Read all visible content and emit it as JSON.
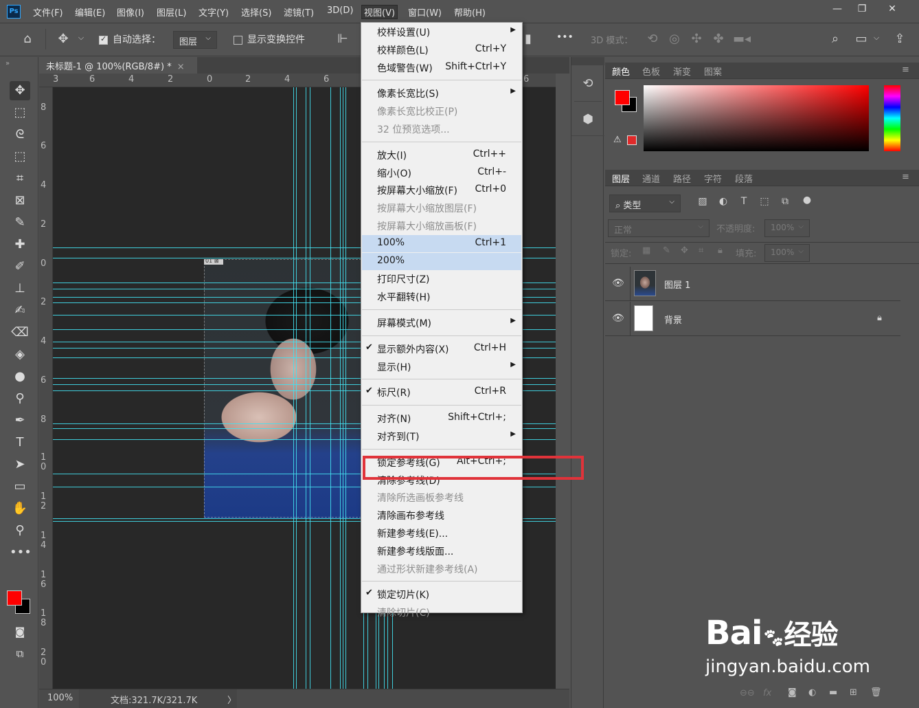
{
  "app": {
    "logo": "Ps"
  },
  "menubar": {
    "items": [
      "文件(F)",
      "编辑(E)",
      "图像(I)",
      "图层(L)",
      "文字(Y)",
      "选择(S)",
      "滤镜(T)",
      "3D(D)",
      "视图(V)",
      "窗口(W)",
      "帮助(H)"
    ],
    "active_index": 8
  },
  "window_controls": {
    "minimize": "—",
    "restore": "❐",
    "close": "✕"
  },
  "options": {
    "auto_select_label": "自动选择：",
    "auto_select_checked": true,
    "auto_select_target": "图层",
    "show_transform_label": "显示变换控件",
    "show_transform_checked": false,
    "more": "•••",
    "mode_3d_label": "3D 模式："
  },
  "document": {
    "tab_title": "未标题-1 @ 100%(RGB/8#) *",
    "tab_close": "×",
    "zoom": "100%",
    "doc_info": "文档:321.7K/321.7K",
    "status_arrow": "〉",
    "slice_badge": "01 ⊠"
  },
  "ruler": {
    "top_labels": [
      "3",
      "6",
      "4",
      "2",
      "0",
      "2",
      "4",
      "6",
      "6"
    ],
    "left_labels": [
      "8",
      "6",
      "4",
      "2",
      "0",
      "2",
      "4",
      "6",
      "8",
      "1\n0",
      "1\n2",
      "1\n4",
      "1\n6",
      "1\n8",
      "2\n0"
    ]
  },
  "view_menu": {
    "items": [
      {
        "label": "校样设置(U)",
        "shortcut": "",
        "submenu": true,
        "disabled": false
      },
      {
        "label": "校样颜色(L)",
        "shortcut": "Ctrl+Y",
        "disabled": false
      },
      {
        "label": "色域警告(W)",
        "shortcut": "Shift+Ctrl+Y",
        "disabled": false
      },
      {
        "sep": true
      },
      {
        "label": "像素长宽比(S)",
        "shortcut": "",
        "submenu": true,
        "disabled": false
      },
      {
        "label": "像素长宽比校正(P)",
        "shortcut": "",
        "disabled": true
      },
      {
        "label": "32 位预览选项...",
        "shortcut": "",
        "disabled": true
      },
      {
        "sep": true
      },
      {
        "label": "放大(I)",
        "shortcut": "Ctrl++",
        "disabled": false
      },
      {
        "label": "缩小(O)",
        "shortcut": "Ctrl+-",
        "disabled": false
      },
      {
        "label": "按屏幕大小缩放(F)",
        "shortcut": "Ctrl+0",
        "disabled": false
      },
      {
        "label": "按屏幕大小缩放图层(F)",
        "shortcut": "",
        "disabled": true
      },
      {
        "label": "按屏幕大小缩放画板(F)",
        "shortcut": "",
        "disabled": true
      },
      {
        "label": "100%",
        "shortcut": "Ctrl+1",
        "disabled": false,
        "highlight": true
      },
      {
        "label": "200%",
        "shortcut": "",
        "disabled": false,
        "highlight": true
      },
      {
        "label": "打印尺寸(Z)",
        "shortcut": "",
        "disabled": false
      },
      {
        "label": "水平翻转(H)",
        "shortcut": "",
        "disabled": false
      },
      {
        "sep": true
      },
      {
        "label": "屏幕模式(M)",
        "shortcut": "",
        "submenu": true,
        "disabled": false
      },
      {
        "sep": true
      },
      {
        "label": "显示额外内容(X)",
        "shortcut": "Ctrl+H",
        "checked": true,
        "disabled": false
      },
      {
        "label": "显示(H)",
        "shortcut": "",
        "submenu": true,
        "disabled": false
      },
      {
        "sep": true
      },
      {
        "label": "标尺(R)",
        "shortcut": "Ctrl+R",
        "checked": true,
        "disabled": false
      },
      {
        "sep": true
      },
      {
        "label": "对齐(N)",
        "shortcut": "Shift+Ctrl+;",
        "disabled": false
      },
      {
        "label": "对齐到(T)",
        "shortcut": "",
        "submenu": true,
        "disabled": false
      },
      {
        "sep": true
      },
      {
        "label": "锁定参考线(G)",
        "shortcut": "Alt+Ctrl+;",
        "disabled": false
      },
      {
        "label": "清除参考线(D)",
        "shortcut": "",
        "disabled": false
      },
      {
        "label": "清除所选画板参考线",
        "shortcut": "",
        "disabled": true
      },
      {
        "label": "清除画布参考线",
        "shortcut": "",
        "disabled": false
      },
      {
        "label": "新建参考线(E)...",
        "shortcut": "",
        "disabled": false
      },
      {
        "label": "新建参考线版面...",
        "shortcut": "",
        "disabled": false
      },
      {
        "label": "通过形状新建参考线(A)",
        "shortcut": "",
        "disabled": true
      },
      {
        "sep": true
      },
      {
        "label": "锁定切片(K)",
        "shortcut": "",
        "checked": true,
        "disabled": false
      },
      {
        "label": "清除切片(C)",
        "shortcut": "",
        "disabled": true
      }
    ]
  },
  "color_panel": {
    "tabs": [
      "颜色",
      "色板",
      "渐变",
      "图案"
    ],
    "active_tab": 0,
    "foreground": "#ff0000",
    "background": "#000000",
    "warning_icon": "⚠"
  },
  "layers_panel": {
    "tabs": [
      "图层",
      "通道",
      "路径",
      "字符",
      "段落"
    ],
    "active_tab": 0,
    "filter_label": "类型",
    "blend_mode": "正常",
    "opacity_label": "不透明度:",
    "opacity_value": "100%",
    "lock_label": "锁定:",
    "fill_label": "填充:",
    "fill_value": "100%",
    "layers": [
      {
        "name": "图层 1",
        "thumb": "photo",
        "locked": false
      },
      {
        "name": "背景",
        "thumb": "white",
        "locked": true
      }
    ]
  },
  "watermark": {
    "brand": "Bai",
    "brand_tail": "经验",
    "url": "jingyan.baidu.com"
  },
  "colors": {
    "guide": "#43e0f0",
    "highlight_box": "#e0333a",
    "menu_hover": "#c7daf1"
  }
}
